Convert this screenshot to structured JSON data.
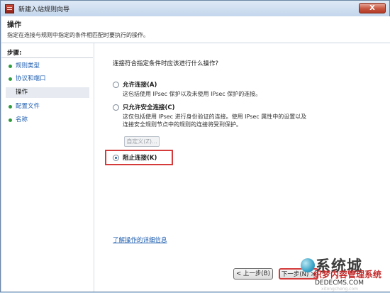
{
  "window": {
    "title": "新建入站规则向导",
    "close_label": "X"
  },
  "header": {
    "title": "操作",
    "description": "指定在连接与规则中指定的条件相匹配时要执行的操作。"
  },
  "sidebar": {
    "heading": "步骤:",
    "items": [
      {
        "label": "规则类型",
        "active": false
      },
      {
        "label": "协议和端口",
        "active": false
      },
      {
        "label": "操作",
        "active": true
      },
      {
        "label": "配置文件",
        "active": false
      },
      {
        "label": "名称",
        "active": false
      }
    ]
  },
  "main": {
    "question": "连接符合指定条件时应该进行什么操作?",
    "options": [
      {
        "label": "允许连接(A)",
        "desc": "这包括使用 IPsec 保护以及未使用 IPsec 保护的连接。",
        "checked": false
      },
      {
        "label": "只允许安全连接(C)",
        "desc": "这仅包括使用 IPsec 进行身份验证的连接。使用 IPsec 属性中的设置以及连接安全规则节点中的规则的连接将受到保护。",
        "checked": false
      },
      {
        "label": "阻止连接(K)",
        "desc": "",
        "checked": true
      }
    ],
    "custom_button": "自定义(Z)...",
    "learn_link": "了解操作的详细信息"
  },
  "footer": {
    "back_label": "< 上一步(B)",
    "next_label": "下一步(N) >"
  },
  "watermark": {
    "brand": "系统城",
    "red_text": "织梦内容管理系统",
    "site": "DEDECMS.COM",
    "small": "xitongcheng.com"
  },
  "colors": {
    "accent_link": "#1f5fb0",
    "highlight": "#d53b3b",
    "step_bullet": "#2f9b3d"
  }
}
